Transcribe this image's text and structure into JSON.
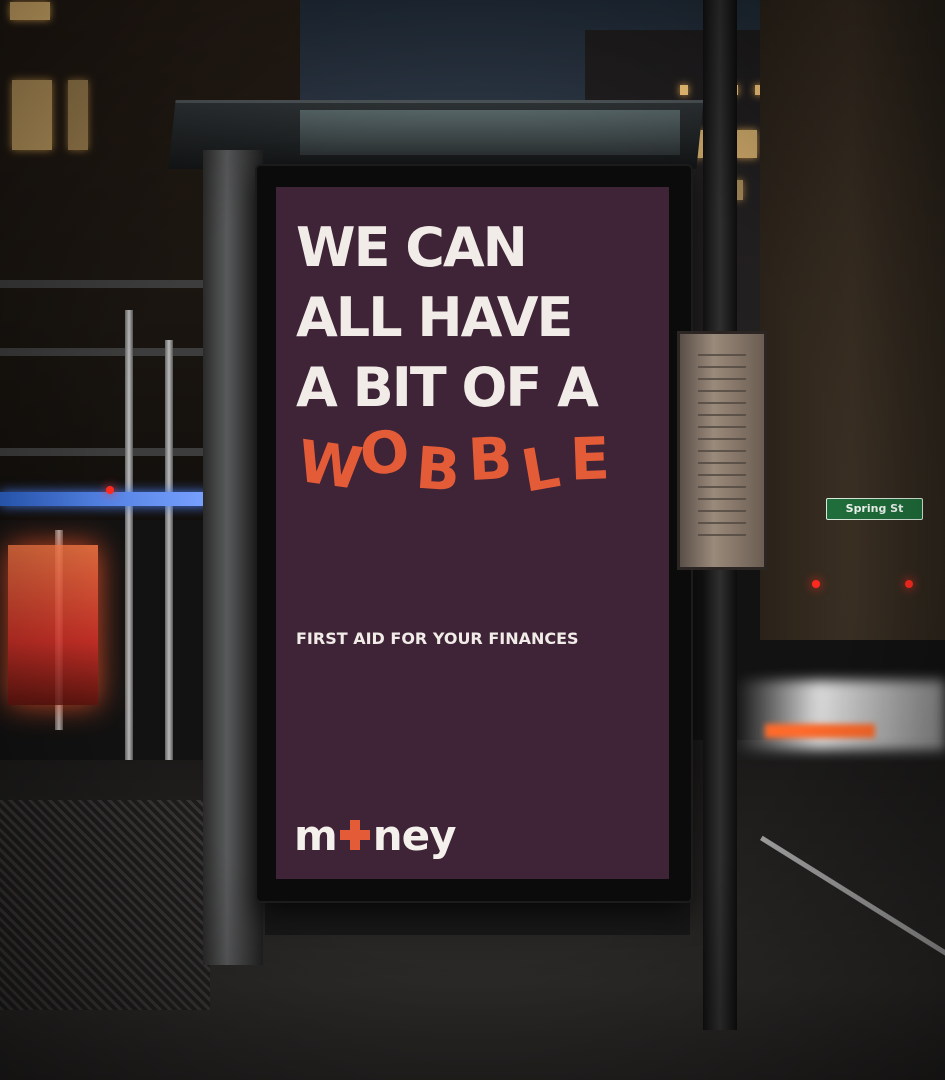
{
  "poster": {
    "headline_lines": [
      "WE CAN",
      "ALL HAVE",
      "A BIT OF A"
    ],
    "wobble_word": "WOBBLE",
    "wobble_letters": [
      "W",
      "O",
      "B",
      "B",
      "L",
      "E"
    ],
    "tagline": "FIRST AID FOR YOUR FINANCES",
    "logo_left": "m",
    "logo_right": "ney",
    "colors": {
      "background": "#3f2336",
      "headline": "#f1ece8",
      "accent": "#e45c37"
    }
  },
  "street_sign": {
    "label": "Spring St"
  },
  "scene": {
    "icons": [
      "plus-cross-icon"
    ]
  }
}
